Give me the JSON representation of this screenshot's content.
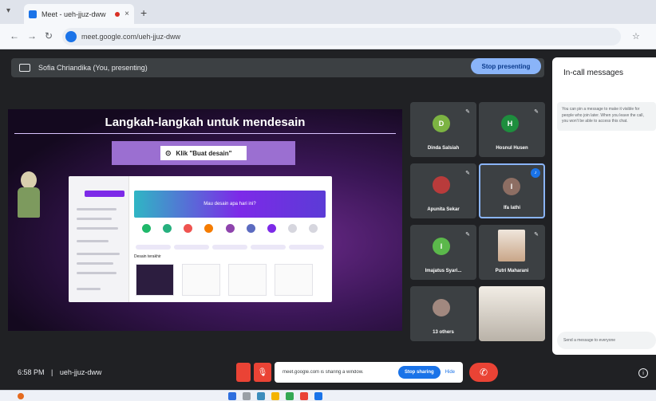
{
  "browser": {
    "tab_title": "Meet - ueh-jjuz-dww",
    "tab_close": "×",
    "new_tab": "+",
    "url": "meet.google.com/ueh-jjuz-dww"
  },
  "meet": {
    "presenting_text": "Sofia Chriandika (You, presenting)",
    "stop_presenting": "Stop presenting",
    "time": "6:58 PM",
    "meeting_code": "ueh-jjuz-dww"
  },
  "slide": {
    "title": "Langkah-langkah untuk  mendesain",
    "step_label": "Klik \"Buat desain\"",
    "banner_text": "Mau desain apa hari ini?",
    "section_label": "Desain terakhir"
  },
  "participants": [
    {
      "name": "Dinda Salsiah",
      "initial": "D",
      "color": "#7cb342"
    },
    {
      "name": "Hosnul Husen",
      "initial": "H",
      "color": "#1e8e3e"
    },
    {
      "name": "Apunita Sekar",
      "initial": "",
      "color": "#b93b3b"
    },
    {
      "name": "Ifa lathi",
      "initial": "I",
      "color": "#8d6e63"
    },
    {
      "name": "Imajatus Syari...",
      "initial": "I",
      "color": "#5bb84b"
    },
    {
      "name": "Putri Maharani",
      "initial": "",
      "color": "#888"
    },
    {
      "name": "13 others",
      "initial": "",
      "color": "#888"
    },
    {
      "name": "",
      "initial": "",
      "color": "#888"
    }
  ],
  "chat": {
    "title": "In-call messages",
    "info": "You can pin a message to make it visible for people who join later. When you leave the call, you won't be able to access this chat.",
    "input_placeholder": "Send a message to everyone"
  },
  "controls": {
    "share_text": "meet.google.com is sharing a window.",
    "stop_sharing": "Stop sharing",
    "hide": "Hide"
  },
  "colors": {
    "accent": "#8ab4f8",
    "danger": "#ea4335",
    "meet_bg": "#202124"
  }
}
